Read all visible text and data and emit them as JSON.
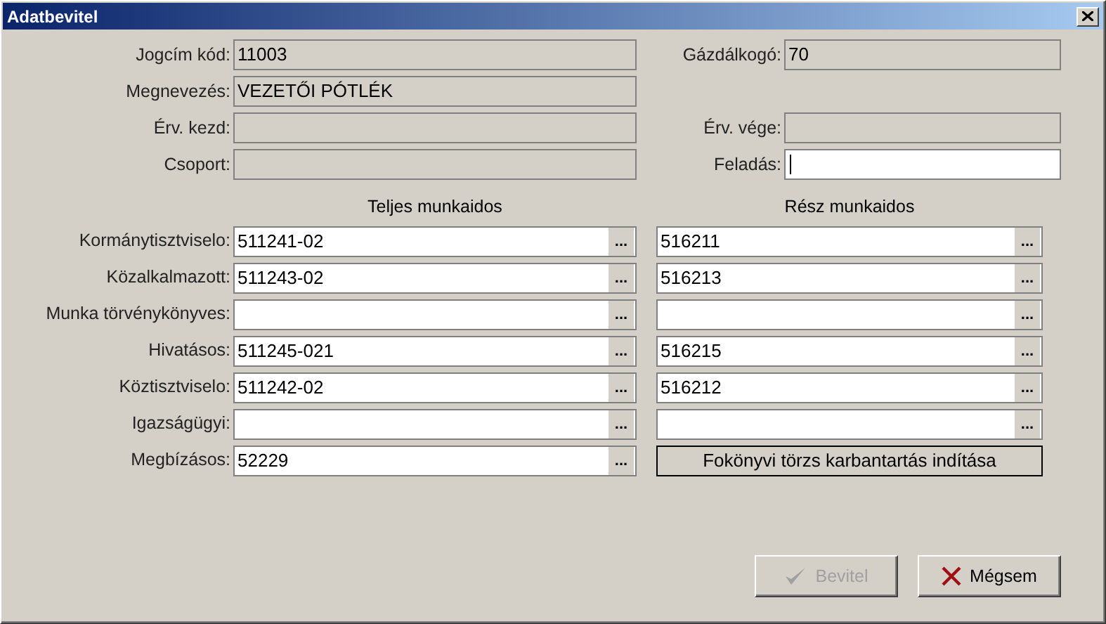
{
  "window": {
    "title": "Adatbevitel"
  },
  "header_rows": [
    {
      "left": {
        "label": "Jogcím kód:",
        "value": "11003",
        "disabled": true
      },
      "right": {
        "label": "Gázdálkogó:",
        "value": "70",
        "disabled": true
      }
    },
    {
      "left": {
        "label": "Megnevezés:",
        "value": "VEZETŐI PÓTLÉK",
        "disabled": true
      }
    },
    {
      "left": {
        "label": "Érv. kezd:",
        "disabled": true
      },
      "right": {
        "label": "Érv. vége:",
        "disabled": true
      }
    },
    {
      "left": {
        "label": "Csoport:",
        "disabled": true
      },
      "right": {
        "label": "Feladás:",
        "disabled": false,
        "focused": true
      }
    }
  ],
  "columns": [
    "Teljes munkaidos",
    "Rész munkaidos"
  ],
  "code_rows": [
    {
      "label": "Kormánytisztviselo:",
      "full": {
        "value": "511241-02",
        "picker": "..."
      },
      "part": {
        "kind": "field",
        "value": "516211",
        "picker": "..."
      }
    },
    {
      "label": "Közalkalmazott:",
      "full": {
        "value": "511243-02",
        "picker": "..."
      },
      "part": {
        "kind": "field",
        "value": "516213",
        "picker": "..."
      }
    },
    {
      "label": "Munka törvénykönyves:",
      "full": {
        "picker": "..."
      },
      "part": {
        "kind": "field",
        "picker": "..."
      }
    },
    {
      "label": "Hivatásos:",
      "full": {
        "value": "511245-021",
        "picker": "..."
      },
      "part": {
        "kind": "field",
        "value": "516215",
        "picker": "..."
      }
    },
    {
      "label": "Köztisztviselo:",
      "full": {
        "value": "511242-02",
        "picker": "..."
      },
      "part": {
        "kind": "field",
        "value": "516212",
        "picker": "..."
      }
    },
    {
      "label": "Igazságügyi:",
      "full": {
        "picker": "..."
      },
      "part": {
        "kind": "field",
        "picker": "..."
      }
    },
    {
      "label": "Megbízásos:",
      "full": {
        "value": "52229",
        "picker": "..."
      },
      "part": {
        "kind": "button",
        "label": "Fokönyvi törzs karbantartás indítása"
      }
    }
  ],
  "buttons": [
    {
      "kind": "ok",
      "label": "Bevitel",
      "disabled": true
    },
    {
      "kind": "cancel",
      "label": "Mégsem",
      "disabled": false
    }
  ]
}
